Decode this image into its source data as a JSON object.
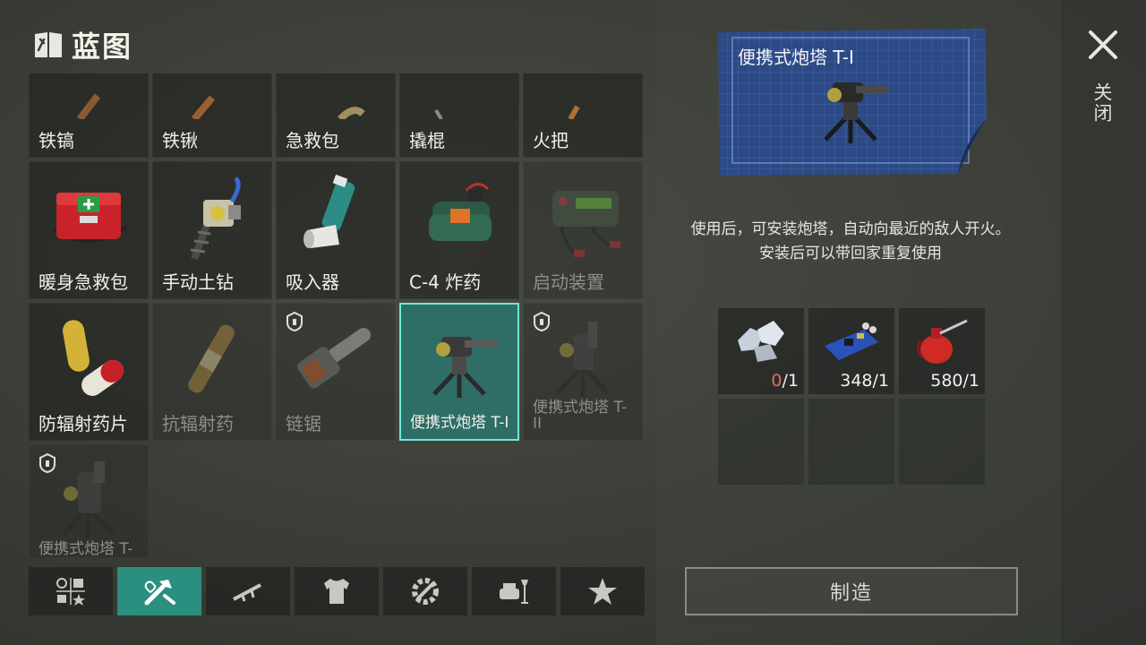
{
  "header": {
    "title": "蓝图"
  },
  "items": [
    {
      "label": "铁镐",
      "state": "normal",
      "icon": "pickaxe-icon"
    },
    {
      "label": "铁锹",
      "state": "normal",
      "icon": "shovel-icon"
    },
    {
      "label": "急救包",
      "state": "normal",
      "icon": "first-aid-icon"
    },
    {
      "label": "撬棍",
      "state": "normal",
      "icon": "crowbar-icon"
    },
    {
      "label": "火把",
      "state": "normal",
      "icon": "torch-icon"
    },
    {
      "label": "暖身急救包",
      "state": "normal",
      "icon": "red-medkit-icon"
    },
    {
      "label": "手动土钻",
      "state": "normal",
      "icon": "hand-drill-icon"
    },
    {
      "label": "吸入器",
      "state": "normal",
      "icon": "inhaler-icon"
    },
    {
      "label": "C-4 炸药",
      "state": "normal",
      "icon": "c4-explosive-icon"
    },
    {
      "label": "启动装置",
      "state": "dim",
      "icon": "jump-starter-icon"
    },
    {
      "label": "防辐射药片",
      "state": "normal",
      "icon": "pills-icon"
    },
    {
      "label": "抗辐射药",
      "state": "dim",
      "icon": "ampoule-icon"
    },
    {
      "label": "链锯",
      "state": "dim-locked",
      "icon": "chainsaw-icon"
    },
    {
      "label": "便携式炮塔 T-I",
      "state": "selected",
      "icon": "turret-icon"
    },
    {
      "label": "便携式炮塔 T-II",
      "state": "dim-locked",
      "icon": "turret-icon"
    },
    {
      "label": "便携式炮塔 T-III",
      "state": "dim-locked",
      "icon": "turret-icon"
    }
  ],
  "tabs": [
    {
      "name": "tab-all",
      "icon": "category-grid-icon",
      "active": false
    },
    {
      "name": "tab-tools",
      "icon": "tools-heart-icon",
      "active": true
    },
    {
      "name": "tab-weapons",
      "icon": "rifle-icon",
      "active": false
    },
    {
      "name": "tab-clothing",
      "icon": "shirt-icon",
      "active": false
    },
    {
      "name": "tab-components",
      "icon": "gears-icon",
      "active": false
    },
    {
      "name": "tab-furniture",
      "icon": "furniture-icon",
      "active": false
    },
    {
      "name": "tab-favorites",
      "icon": "star-icon",
      "active": false
    }
  ],
  "detail": {
    "title": "便携式炮塔 T-I",
    "description_line1": "使用后，可安装炮塔，自动向最近的敌人开火。",
    "description_line2": "安装后可以带回家重复使用",
    "materials": [
      {
        "icon": "metal-scrap-icon",
        "have": "0",
        "need": "/1",
        "low": true
      },
      {
        "icon": "circuit-board-icon",
        "have": "348",
        "need": "/1",
        "low": false
      },
      {
        "icon": "oil-can-icon",
        "have": "580",
        "need": "/1",
        "low": false
      }
    ],
    "craft_label": "制造"
  },
  "close": {
    "label": "关闭"
  },
  "colors": {
    "accent": "#2b8f7f",
    "selected_border": "#6ee8d8",
    "low": "#e86a5c",
    "blueprint": "#2c4a86"
  }
}
